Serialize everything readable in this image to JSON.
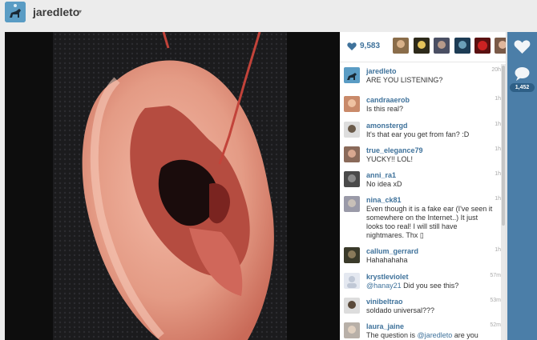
{
  "header": {
    "username": "jaredleto",
    "caret": "▾"
  },
  "post": {
    "likes": "9,583",
    "caption": {
      "user": "jaredleto",
      "time": "20h",
      "text": "ARE YOU LISTENING?"
    }
  },
  "sidebar": {
    "comment_count": "1,452"
  },
  "comments": [
    {
      "user": "candraaerob",
      "time": "1h",
      "text": "Is this real?"
    },
    {
      "user": "amonstergd",
      "time": "1h",
      "text": "It's that ear you get from fan? :D"
    },
    {
      "user": "true_elegance79",
      "time": "1h",
      "text": "YUCKY!! LOL!"
    },
    {
      "user": "anni_ra1",
      "time": "1h",
      "text": "No idea xD"
    },
    {
      "user": "nina_ck81",
      "time": "1h",
      "text": "Even though it is a fake ear (I've seen it somewhere on the Internet..) It just looks too real! I will still have nightmares. Thx ▯"
    },
    {
      "user": "callum_gerrard",
      "time": "1h",
      "text": "Hahahahaha"
    },
    {
      "user": "krystleviolet",
      "time": "57m",
      "mention": "@hanay21",
      "text": " Did you see this?"
    },
    {
      "user": "vinibeltrao",
      "time": "53m",
      "text": "soldado universal???"
    },
    {
      "user": "laura_jaine",
      "time": "52m",
      "text": "The question is ",
      "mention": "@jaredleto",
      "text2": " are you"
    }
  ],
  "colors": {
    "link": "#3f729b",
    "sidebar": "#4b7ea8",
    "ear": "#e8a08c"
  },
  "icons": [
    "heart-icon",
    "comment-icon",
    "caret-down-icon",
    "avatar-icon"
  ]
}
